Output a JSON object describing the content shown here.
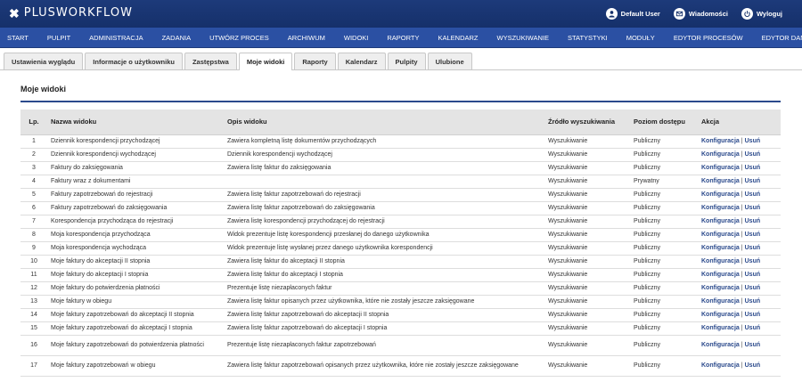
{
  "header": {
    "logo_mark": "✖",
    "logo_text": "PLUSWORKFLOW",
    "user_label": "Default User",
    "messages_label": "Wiadomości",
    "logout_label": "Wyloguj"
  },
  "nav": [
    "START",
    "PULPIT",
    "ADMINISTRACJA",
    "ZADANIA",
    "UTWÓRZ PROCES",
    "ARCHIWUM",
    "WIDOKI",
    "RAPORTY",
    "KALENDARZ",
    "WYSZUKIWANIE",
    "STATYSTYKI",
    "MODUŁY",
    "EDYTOR PROCESÓW",
    "EDYTOR DANYCH"
  ],
  "tabs": [
    "Ustawienia wyglądu",
    "Informacje o użytkowniku",
    "Zastępstwa",
    "Moje widoki",
    "Raporty",
    "Kalendarz",
    "Pulpity",
    "Ulubione"
  ],
  "active_tab": 3,
  "page_title": "Moje widoki",
  "table": {
    "headers": [
      "Lp.",
      "Nazwa widoku",
      "Opis widoku",
      "Źródło wyszukiwania",
      "Poziom dostępu",
      "Akcja"
    ],
    "config_label": "Konfiguracja",
    "separator": "|",
    "delete_label": "Usuń",
    "rows": [
      [
        "1",
        "Dziennik korespondencji przychodzącej",
        "Zawiera kompletną listę dokumentów przychodzących",
        "Wyszukiwanie",
        "Publiczny"
      ],
      [
        "2",
        "Dziennik korespondencji wychodzącej",
        "Dziennik korespondencji wychodzącej",
        "Wyszukiwanie",
        "Publiczny"
      ],
      [
        "3",
        "Faktury do zaksięgowania",
        "Zawiera listę faktur do zaksięgowania",
        "Wyszukiwanie",
        "Publiczny"
      ],
      [
        "4",
        "Faktury wraz z dokumentami",
        "",
        "Wyszukiwanie",
        "Prywatny"
      ],
      [
        "5",
        "Faktury zapotrzebowań do rejestracji",
        "Zawiera listę faktur zapotrzebowań do rejestracji",
        "Wyszukiwanie",
        "Publiczny"
      ],
      [
        "6",
        "Faktury zapotrzebowań do zaksięgowania",
        "Zawiera listę faktur zapotrzebowań do zaksięgowania",
        "Wyszukiwanie",
        "Publiczny"
      ],
      [
        "7",
        "Korespondencja przychodząca do rejestracji",
        "Zawiera listę korespondencji przychodzącej do rejestracji",
        "Wyszukiwanie",
        "Publiczny"
      ],
      [
        "8",
        "Moja korespondencja przychodząca",
        "Widok prezentuje listę korespondencji przesłanej do danego użytkownika",
        "Wyszukiwanie",
        "Publiczny"
      ],
      [
        "9",
        "Moja korespondencja wychodząca",
        "Widok prezentuje listę wysłanej przez danego użytkownika korespondencji",
        "Wyszukiwanie",
        "Publiczny"
      ],
      [
        "10",
        "Moje faktury do akceptacji II stopnia",
        "Zawiera listę faktur do akceptacji II stopnia",
        "Wyszukiwanie",
        "Publiczny"
      ],
      [
        "11",
        "Moje faktury do akceptacji I stopnia",
        "Zawiera listę faktur do akceptacji I stopnia",
        "Wyszukiwanie",
        "Publiczny"
      ],
      [
        "12",
        "Moje faktury do potwierdzenia płatności",
        "Prezentuje listę niezapłaconych faktur",
        "Wyszukiwanie",
        "Publiczny"
      ],
      [
        "13",
        "Moje faktury w obiegu",
        "Zawiera listę faktur opisanych przez użytkownika, które nie zostały jeszcze zaksięgowane",
        "Wyszukiwanie",
        "Publiczny"
      ],
      [
        "14",
        "Moje faktury zapotrzebowań do akceptacji II stopnia",
        "Zawiera listę faktur zapotrzebowań do akceptacji II stopnia",
        "Wyszukiwanie",
        "Publiczny"
      ],
      [
        "15",
        "Moje faktury zapotrzebowań do akceptacji I stopnia",
        "Zawiera listę faktur zapotrzebowań do akceptacji I stopnia",
        "Wyszukiwanie",
        "Publiczny"
      ],
      [
        "16",
        "Moje faktury zapotrzebowań do potwierdzenia płatności",
        "Prezentuje listę niezapłaconych faktur zapotrzebowań",
        "Wyszukiwanie",
        "Publiczny"
      ],
      [
        "17",
        "Moje faktury zapotrzebowań w obiegu",
        "Zawiera listę faktur zapotrzebowań opisanych przez użytkownika, które nie zostały jeszcze zaksięgowane",
        "Wyszukiwanie",
        "Publiczny"
      ]
    ]
  },
  "colors": {
    "header_bg": "#15306a",
    "nav_bg": "#2b50a3",
    "link": "#2b4a8c"
  }
}
